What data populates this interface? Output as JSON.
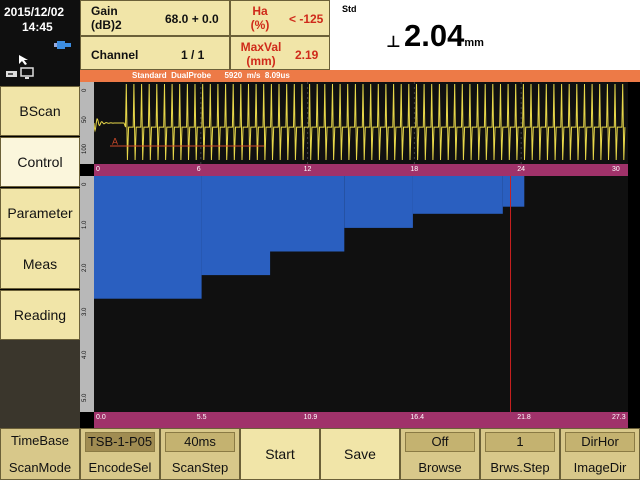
{
  "status": {
    "date": "2015/12/02",
    "time": "14:45",
    "icons": [
      "cursor-icon",
      "connector-icon",
      "storage-icon",
      "monitor-icon"
    ]
  },
  "params": {
    "gain_label": "Gain (dB)2",
    "gain_value": "68.0 + 0.0",
    "channel_label": "Channel",
    "channel_value": "1 / 1",
    "ha_label": "Ha (%)",
    "ha_value": "< -125",
    "maxval_label": "MaxVal (mm)",
    "maxval_value": "2.19"
  },
  "readout": {
    "mode": "Std",
    "symbol": "⊥",
    "value": "2.04",
    "unit": "mm"
  },
  "probe_bar": "Standard  DualProbe      5920  m/s  8.09us",
  "menu": [
    {
      "label": "BScan",
      "active": false
    },
    {
      "label": "Control",
      "active": true
    },
    {
      "label": "Parameter",
      "active": false
    },
    {
      "label": "Meas",
      "active": false
    },
    {
      "label": "Reading",
      "active": false
    }
  ],
  "ascan": {
    "x_ticks": [
      "0",
      "6",
      "12",
      "18",
      "24",
      "30"
    ],
    "y_ticks": [
      "0",
      "50",
      "100"
    ],
    "gate_label": "A",
    "colors": {
      "signal": "#e8d84a",
      "background": "#101010",
      "gate": "#d04a2a"
    }
  },
  "bscan": {
    "x_ticks": [
      "0.0",
      "5.5",
      "10.9",
      "16.4",
      "21.8",
      "27.3"
    ],
    "y_ticks": [
      "0",
      "1.0",
      "2.0",
      "3.0",
      "4.0",
      "5.0"
    ],
    "colors": {
      "filled": "#2a5fc0",
      "empty": "#101010",
      "cursor": "#c82020"
    },
    "cursor_fraction": 0.78,
    "fill_fraction": 0.78,
    "steps": [
      {
        "x_end": 5.5,
        "depth": 2.6
      },
      {
        "x_end": 9.0,
        "depth": 2.1
      },
      {
        "x_end": 12.8,
        "depth": 1.6
      },
      {
        "x_end": 16.3,
        "depth": 1.1
      },
      {
        "x_end": 20.9,
        "depth": 0.8
      },
      {
        "x_end": 22.0,
        "depth": 0.65
      }
    ]
  },
  "toolbar": [
    {
      "top": "TimeBase",
      "bottom": "ScanMode",
      "dark": false,
      "box": false
    },
    {
      "top": "TSB-1-P05",
      "bottom": "EncodeSel",
      "dark": true,
      "box": true
    },
    {
      "top": "40ms",
      "bottom": "ScanStep",
      "dark": false,
      "box": true
    },
    {
      "single": "Start"
    },
    {
      "single": "Save"
    },
    {
      "top": "Off",
      "bottom": "Browse",
      "dark": false,
      "box": true
    },
    {
      "top": "1",
      "bottom": "Brws.Step",
      "dark": false,
      "box": true
    },
    {
      "top": "DirHor",
      "bottom": "ImageDir",
      "dark": false,
      "box": true
    }
  ]
}
